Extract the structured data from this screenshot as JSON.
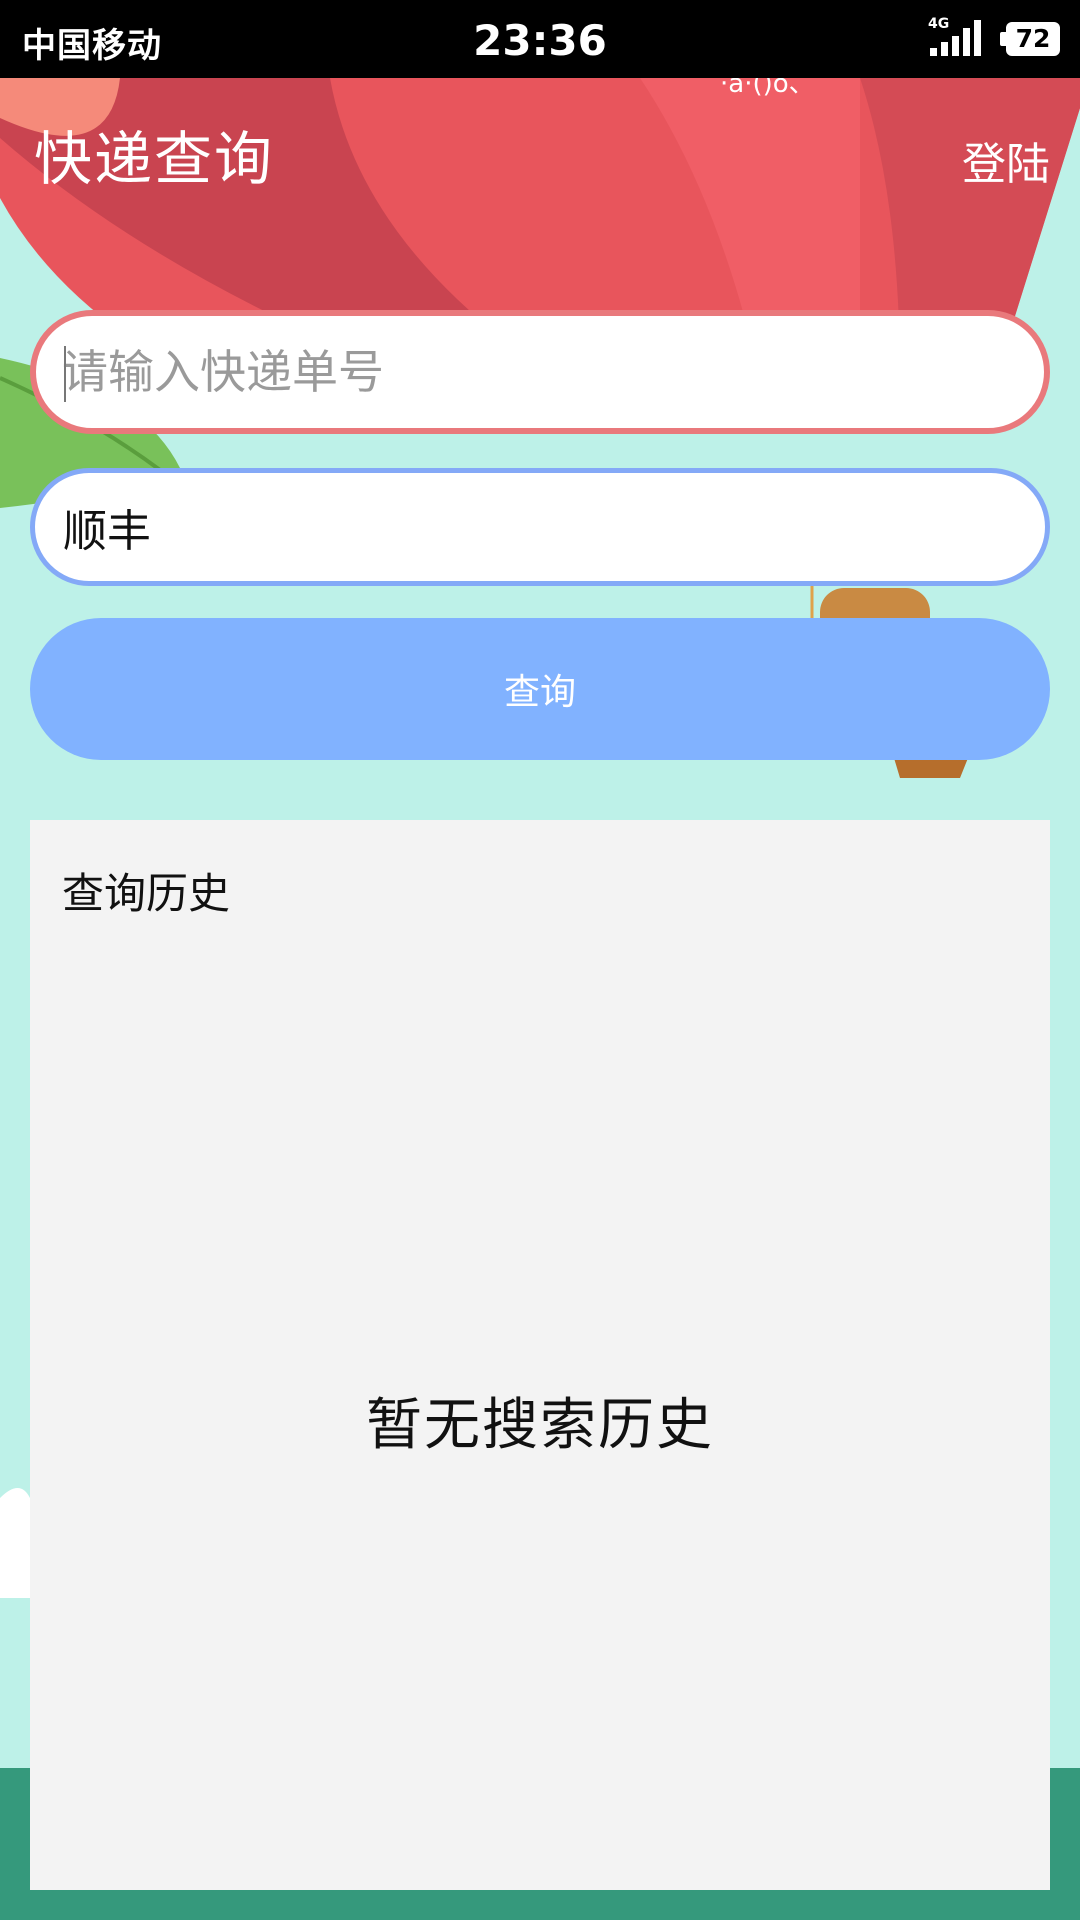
{
  "status_bar": {
    "carrier": "中国移动",
    "time": "23:36",
    "network": "4G",
    "battery": "72"
  },
  "header": {
    "title": "快递查询",
    "login_label": "登陆"
  },
  "form": {
    "tracking_placeholder": "请输入快递单号",
    "tracking_value": "",
    "carrier_value": "顺丰",
    "query_label": "查询"
  },
  "history": {
    "title": "查询历史",
    "empty_text": "暂无搜索历史"
  },
  "colors": {
    "background": "#bdf1e8",
    "accent_blue": "#81b2ff",
    "tracking_border": "#e9797c",
    "carrier_border": "#84a9f7",
    "panel": "#f3f3f3",
    "ground": "#35997c"
  }
}
